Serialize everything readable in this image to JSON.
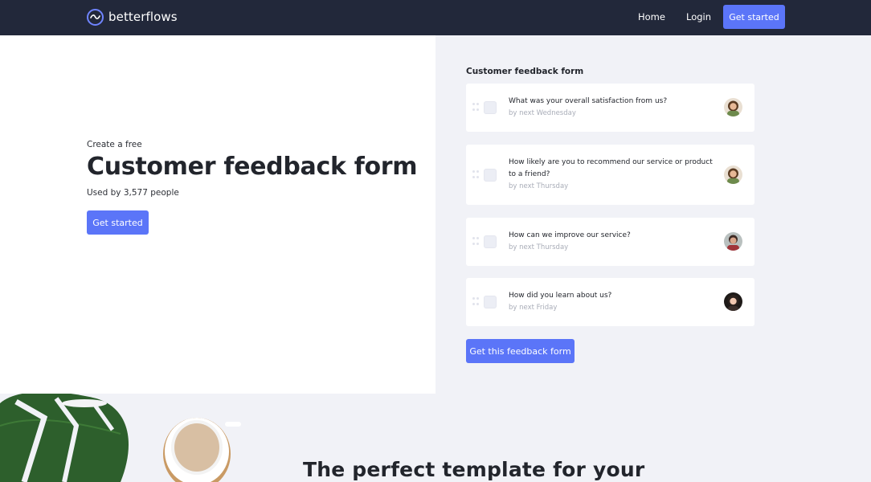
{
  "nav": {
    "brand": "betterflows",
    "links": [
      "Home",
      "Login"
    ],
    "cta": "Get started"
  },
  "hero": {
    "eyebrow": "Create a free",
    "title": "Customer feedback form",
    "subtitle": "Used by 3,577 people",
    "cta": "Get started"
  },
  "preview": {
    "title": "Customer feedback form",
    "items": [
      {
        "question": "What was your overall satisfaction from us?",
        "due": "by next Wednesday",
        "avatar": "avatar-icon"
      },
      {
        "question": "How likely are you to recommend our service or product to a friend?",
        "due": "by next Thursday",
        "avatar": "avatar-icon"
      },
      {
        "question": "How can we improve our service?",
        "due": "by next Thursday",
        "avatar": "avatar-icon"
      },
      {
        "question": "How did you learn about us?",
        "due": "by next Friday",
        "avatar": "avatar-icon"
      }
    ],
    "cta": "Get this feedback form"
  },
  "bottom": {
    "heading": "The perfect template for your"
  },
  "colors": {
    "nav_bg": "#22283a",
    "accent": "#5b75f8",
    "panel_bg": "#f1f2f7"
  }
}
